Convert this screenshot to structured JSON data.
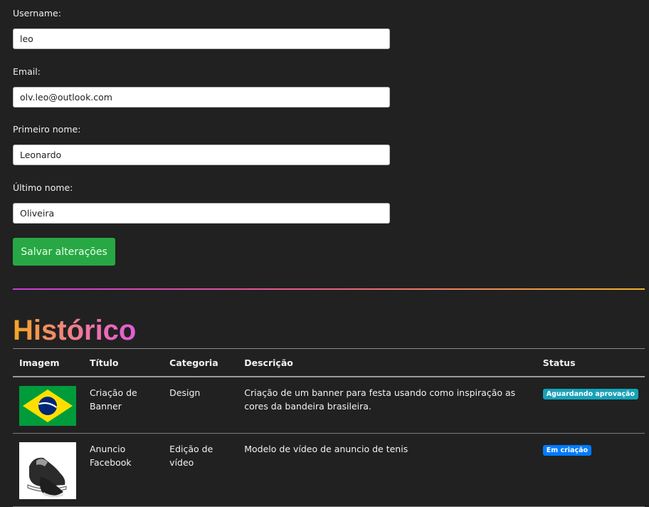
{
  "form": {
    "username_label": "Username:",
    "username_value": "leo",
    "email_label": "Email:",
    "email_value": "olv.leo@outlook.com",
    "first_name_label": "Primeiro nome:",
    "first_name_value": "Leonardo",
    "last_name_label": "Último nome:",
    "last_name_value": "Oliveira",
    "save_label": "Salvar alterações"
  },
  "history": {
    "title": "Histórico",
    "columns": [
      "Imagem",
      "Título",
      "Categoria",
      "Descrição",
      "Status"
    ],
    "rows": [
      {
        "image": "brazil-flag-image",
        "title": "Criação de Banner",
        "category": "Design",
        "description": "Criação de um banner para festa usando como inspiração as cores da bandeira brasileira.",
        "status": "Aguardando aprovação",
        "status_color": "#17a2b8"
      },
      {
        "image": "sneaker-image",
        "title": "Anuncio Facebook",
        "category": "Edição de vídeo",
        "description": "Modelo de vídeo de anuncio de tenis",
        "status": "Em criação",
        "status_color": "#007bff"
      }
    ]
  },
  "colors": {
    "background": "#212121",
    "save_button": "#27a844",
    "title_gradient_start": "#f5a623",
    "title_gradient_end": "#e25bd6"
  }
}
